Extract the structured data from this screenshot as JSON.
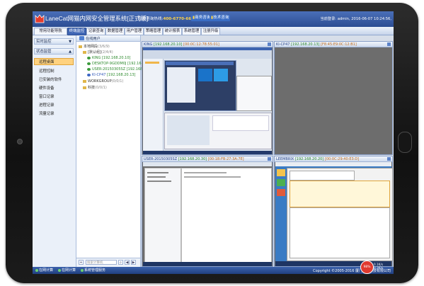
{
  "app": {
    "title": "LaneCat网猫内网安全管理系统[正式版]",
    "hotline_label": "免费咨询热线:",
    "hotline_number": "400-6770-668",
    "btn_consult": "商务咨询",
    "btn_support": "技术咨询",
    "user_info": "当前登录: admin, 2016-06-07 10:24:56,"
  },
  "nav": {
    "tabs": [
      "常用功能导航",
      "终端监控",
      "记录查询",
      "数据管理",
      "用户管理",
      "策略管理",
      "统计报表",
      "系统管理",
      "注册升级"
    ],
    "active": "终端监控"
  },
  "left": {
    "sections": [
      "实时监控",
      "状态监管"
    ],
    "items": [
      "远程桌面",
      "远程控制",
      "已安装的软件",
      "硬件设备",
      "窗口记录",
      "进程记录",
      "流量记录"
    ],
    "active_item": "远程桌面"
  },
  "tree": {
    "header": "在线用户",
    "nodes": [
      {
        "label": "本地网段",
        "count": "(3/6/9)"
      },
      {
        "label": "[默认组]",
        "count": "(2/4/4)"
      },
      {
        "label": "KING",
        "ip": "[192.168.20.10]"
      },
      {
        "label": "DESKTOP-9GDDM0J",
        "ip": "[192.168.20.12]"
      },
      {
        "label": "USER-20150305SZ",
        "ip": "[192.168.20.30]"
      },
      {
        "label": "KI-CP47",
        "ip": "[192.168.20.13]"
      },
      {
        "label": "WORKGROUP",
        "count": "(0/0/1)"
      },
      {
        "label": "科技",
        "count": "(0/0/1)"
      }
    ],
    "search_placeholder": "搜索计算机"
  },
  "panes": [
    {
      "name": "KING",
      "ip": "[192.168.20.10]",
      "mac": "[00:0C:12:78:55:01]"
    },
    {
      "name": "KI-CP47",
      "ip": "[192.168.20.13]",
      "mac": "[F8:45:E9:0C:12:B1]"
    },
    {
      "name": "USER-20150305SZ",
      "ip": "[192.168.20.30]",
      "mac": "[00:1B:FB:27:3A:7E]"
    },
    {
      "name": "LEEMBRIX",
      "ip": "[192.168.20.20]",
      "mac": "[00:0C:29:40:E3:D]"
    }
  ],
  "status": {
    "item1": "在网计算",
    "item2": "在网计算",
    "item3": "系统管理服务",
    "copyright": "Copyright ©2005-2016 厦门蓝猫科技有限公司",
    "gauge": "98%",
    "net_up": "0.1K/s",
    "net_down": "0.3K/s"
  },
  "colors": {
    "title_bg": "#2c4d93",
    "accent": "#3f66b4",
    "highlight": "#ffd27f",
    "online_green": "#2c8a2c"
  }
}
